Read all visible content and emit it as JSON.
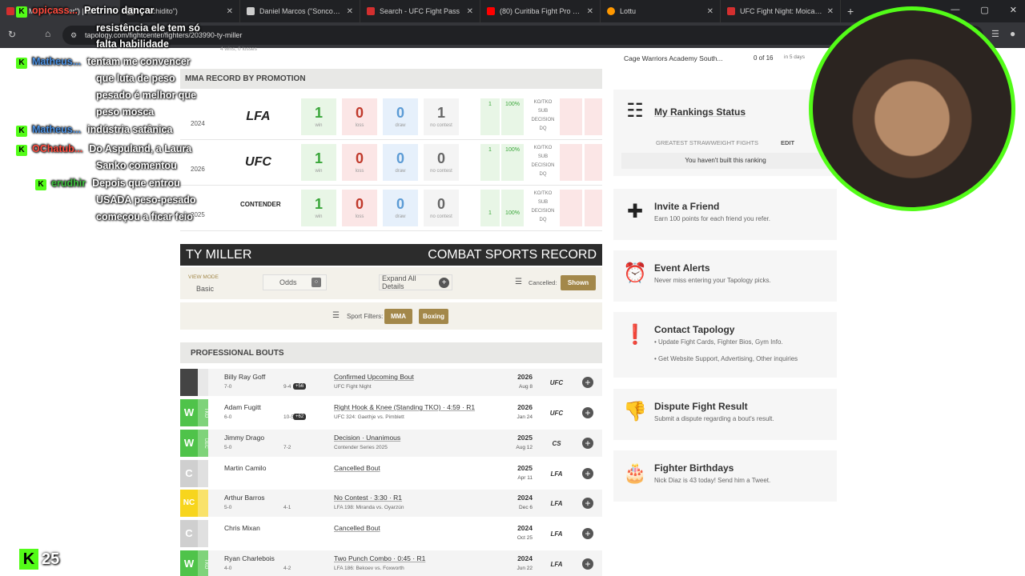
{
  "tabs": [
    {
      "label": "Ty Miller (\"Thriller\") | MMA",
      "color": "#d32f2f"
    },
    {
      "label": "(\"Tachidito\")",
      "color": "#888888"
    },
    {
      "label": "Daniel Marcos (\"Soncora\")",
      "color": "#cccccc"
    },
    {
      "label": "Search - UFC Fight Pass",
      "color": "#d32f2f"
    },
    {
      "label": "(80) Curitiba Fight Pro 11 -",
      "color": "#ff0000"
    },
    {
      "label": "Lottu",
      "color": "#ff9800"
    },
    {
      "label": "UFC Fight Night: Moicano",
      "color": "#d32f2f"
    }
  ],
  "url": "tapology.com/fightcenter/fighters/203990-ty-miller",
  "chat": [
    {
      "user": "opicass...",
      "text": "Petrino dançar"
    },
    {
      "user": "",
      "text": "resistência ele tem só"
    },
    {
      "user": "",
      "text": "falta habilidade"
    },
    {
      "user": "Matheus...",
      "text": "tentam me convencer"
    },
    {
      "user": "",
      "text": "que luta de peso"
    },
    {
      "user": "",
      "text": "pesado é melhor que"
    },
    {
      "user": "",
      "text": "peso mosca"
    },
    {
      "user": "Matheus...",
      "text": "indústria satânica"
    },
    {
      "user": "OChatub...",
      "text": "Do Aspuland, a Laura"
    },
    {
      "user": "",
      "text": "Sanko comentou"
    },
    {
      "user": "erudhir",
      "text": "Depois que entrou"
    },
    {
      "user": "",
      "text": "USADA peso-pesado"
    },
    {
      "user": "",
      "text": "começou a ficar feio"
    }
  ],
  "kick_count": "25",
  "record_stub": "4 wins, 0 losses",
  "mma_record_by_promotion": {
    "title": "MMA RECORD BY PROMOTION",
    "rows": [
      {
        "year": "2024",
        "org": "LFA",
        "win": "1",
        "loss": "0",
        "draw": "0",
        "nc": "1",
        "ko": "1",
        "ko_pct": "100%"
      },
      {
        "year": "2026",
        "org": "UFC",
        "win": "1",
        "loss": "0",
        "draw": "0",
        "nc": "0",
        "ko": "1",
        "ko_pct": "100%"
      },
      {
        "year": "2025",
        "org": "CONTENDER",
        "win": "1",
        "loss": "0",
        "draw": "0",
        "nc": "0",
        "ko": "1",
        "ko_pct": "100%"
      }
    ],
    "labels": {
      "win": "win",
      "loss": "loss",
      "draw": "draw",
      "nc": "no contest",
      "methods": "KO/TKO SUB DECISION DQ"
    }
  },
  "combat": {
    "name": "TY MILLER",
    "title": "COMBAT SPORTS RECORD"
  },
  "view": {
    "mode_label": "VIEW MODE",
    "mode": "Basic",
    "odds": "Odds",
    "expand": "Expand All Details",
    "cancelled": "Cancelled:",
    "shown": "Shown"
  },
  "filters": {
    "label": "Sport Filters:",
    "mma": "MMA",
    "boxing": "Boxing"
  },
  "bouts_title": "PROFESSIONAL BOUTS",
  "bouts": [
    {
      "res": "",
      "meth": "",
      "color": "#444",
      "opp": "Billy Ray Goff",
      "orec": "7-0",
      "oprec": "9-4",
      "streak": "+56",
      "desc": "Confirmed Upcoming Bout",
      "event": "UFC Fight Night",
      "year": "2026",
      "date": "Aug 8",
      "org": "UFC"
    },
    {
      "res": "W",
      "meth": "TKO",
      "color": "#4fc34a",
      "opp": "Adam Fugitt",
      "orec": "6-0",
      "oprec": "10-5",
      "streak": "+62",
      "desc": "Right Hook & Knee (Standing TKO) · 4:59 · R1",
      "event": "UFC 324: Gaethje vs. Pimblett",
      "year": "2026",
      "date": "Jan 24",
      "org": "UFC"
    },
    {
      "res": "W",
      "meth": "DEC",
      "color": "#4fc34a",
      "opp": "Jimmy Drago",
      "orec": "5-0",
      "oprec": "7-2",
      "streak": "",
      "desc": "Decision · Unanimous",
      "event": "Contender Series 2025",
      "year": "2025",
      "date": "Aug 12",
      "org": "CS"
    },
    {
      "res": "C",
      "meth": "",
      "color": "#cfcfcf",
      "opp": "Martin Camilo",
      "orec": "",
      "oprec": "",
      "streak": "",
      "desc": "Cancelled Bout",
      "event": "",
      "year": "2025",
      "date": "Apr 11",
      "org": "LFA"
    },
    {
      "res": "NC",
      "meth": "",
      "color": "#f7d51d",
      "opp": "Arthur Barros",
      "orec": "5-0",
      "oprec": "4-1",
      "streak": "",
      "desc": "No Contest · 3:30 · R1",
      "event": "LFA 198: Miranda vs. Oyarzún",
      "year": "2024",
      "date": "Dec 6",
      "org": "LFA"
    },
    {
      "res": "C",
      "meth": "",
      "color": "#cfcfcf",
      "opp": "Chris Mixan",
      "orec": "",
      "oprec": "",
      "streak": "",
      "desc": "Cancelled Bout",
      "event": "",
      "year": "2024",
      "date": "Oct 25",
      "org": "LFA"
    },
    {
      "res": "W",
      "meth": "TKO",
      "color": "#4fc34a",
      "opp": "Ryan Charlebois",
      "orec": "4-0",
      "oprec": "4-2",
      "streak": "",
      "desc": "Two Punch Combo · 0:45 · R1",
      "event": "LFA 186: Bekoev vs. Foxworth",
      "year": "2024",
      "date": "Jun 22",
      "org": "LFA"
    }
  ],
  "sidebar": {
    "cage": {
      "event": "Cage Warriors Academy South...",
      "count": "0 of 16",
      "when": "in 5 days"
    },
    "rankings": {
      "title": "My Rankings Status",
      "category": "GREATEST STRAWWEIGHT FIGHTS",
      "edit": "EDIT",
      "empty": "You haven't built this ranking"
    },
    "cards": [
      {
        "title": "Invite a Friend",
        "sub": "Earn 100 points for each friend you refer.",
        "icon": "invite-icon"
      },
      {
        "title": "Event Alerts",
        "sub": "Never miss entering your Tapology picks.",
        "icon": "alarm-icon"
      },
      {
        "title": "Contact Tapology",
        "sub": "• Update Fight Cards, Fighter Bios, Gym Info.",
        "sub2": "• Get Website Support, Advertising, Other inquiries",
        "icon": "alert-icon"
      },
      {
        "title": "Dispute Fight Result",
        "sub": "Submit a dispute regarding a bout's result.",
        "icon": "thumbs-down-icon"
      },
      {
        "title": "Fighter Birthdays",
        "sub": "Nick Diaz is 43 today! Send him a Tweet.",
        "icon": "cake-icon"
      }
    ]
  }
}
